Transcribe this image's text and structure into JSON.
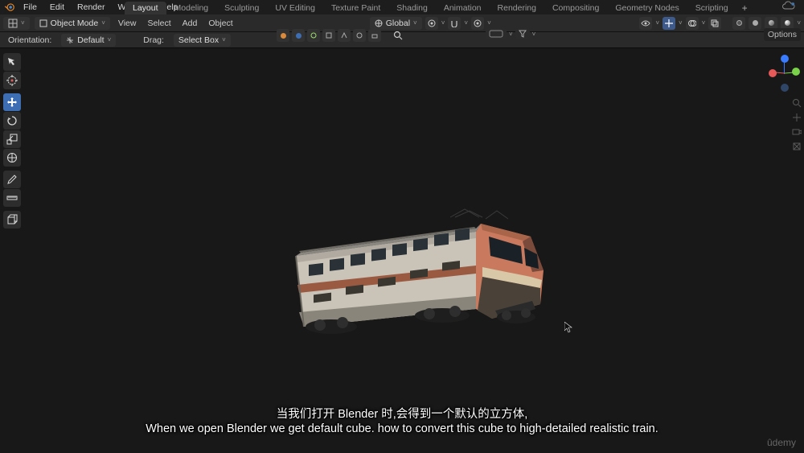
{
  "app": {
    "name": "Blender"
  },
  "menubar": {
    "items": [
      "File",
      "Edit",
      "Render",
      "Window",
      "Help"
    ]
  },
  "workspace": {
    "tabs": [
      "Layout",
      "Modeling",
      "Sculpting",
      "UV Editing",
      "Texture Paint",
      "Shading",
      "Animation",
      "Rendering",
      "Compositing",
      "Geometry Nodes",
      "Scripting"
    ],
    "active_index": 0,
    "add_label": "+"
  },
  "header2": {
    "mode": "Object Mode",
    "menu_items": [
      "View",
      "Select",
      "Add",
      "Object"
    ],
    "orientation": "Global",
    "snap_chev": "˅",
    "drag_label": "˅"
  },
  "header3": {
    "orientation_label": "Orientation:",
    "orientation_value": "Default",
    "drag_label": "Drag:",
    "drag_value": "Select Box",
    "options_label": "Options"
  },
  "overlay_toggles": {
    "colors": [
      "#d98a3a",
      "#3d6db3",
      "#9edc6b",
      "#a3a3a3",
      "#a3a3a3",
      "#a3a3a3",
      "#a3a3a3"
    ]
  },
  "filter": {
    "placeholder": ""
  },
  "left_tools": [
    {
      "name": "cursor-tool",
      "active": false
    },
    {
      "name": "select-tool",
      "active": false
    },
    {
      "gap": true
    },
    {
      "name": "move-tool",
      "active": true
    },
    {
      "name": "rotate-tool",
      "active": false
    },
    {
      "name": "scale-tool",
      "active": false
    },
    {
      "name": "transform-tool",
      "active": false
    },
    {
      "gap": true
    },
    {
      "name": "annotate-tool",
      "active": false
    },
    {
      "name": "measure-tool",
      "active": false
    },
    {
      "gap": true
    },
    {
      "name": "add-primitive-tool",
      "active": false
    }
  ],
  "gizmo": {
    "z": "#3a7cff",
    "y": "#7ad24a",
    "x": "#e85a5a",
    "neg": "#4a6a9a"
  },
  "subtitles": {
    "line1": "当我们打开 Blender 时,会得到一个默认的立方体,",
    "line2": "When we open Blender we get default cube. how to convert this cube to high-detailed realistic train."
  },
  "watermark": "ûdemy",
  "cursor_glyph": "▸"
}
